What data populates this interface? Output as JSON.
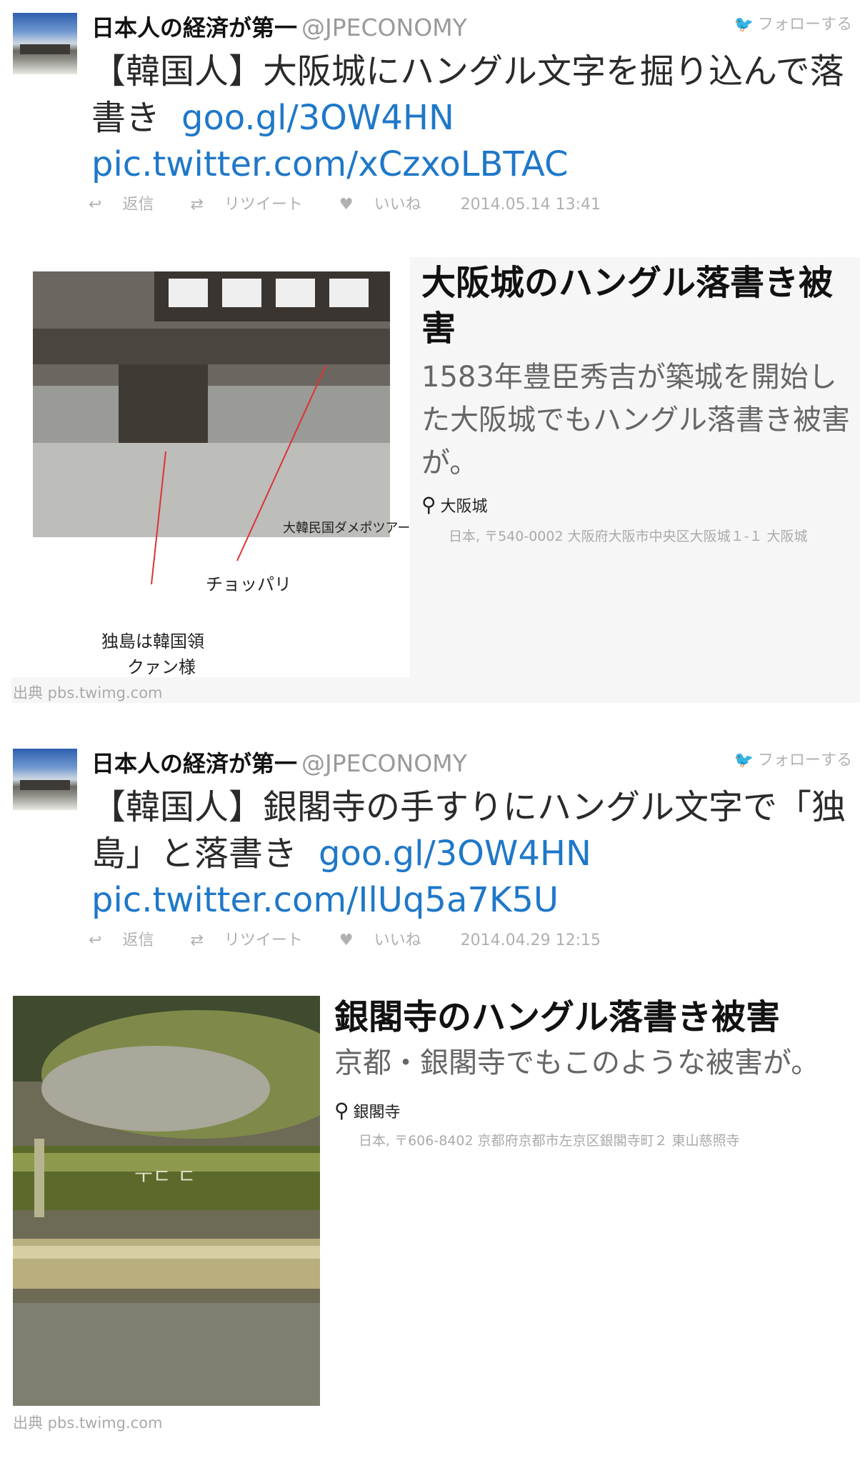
{
  "tweets": [
    {
      "name": "日本人の経済が第一",
      "handle": "@JPECONOMY",
      "follow_label": "フォローする",
      "text": "【韓国人】大阪城にハングル文字を掘り込んで落書き",
      "link": "goo.gl/3OW4HN",
      "pic_link": "pic.twitter.com/xCzxoLBTAC",
      "actions": {
        "reply": "返信",
        "retweet": "リツイート",
        "like": "いいね"
      },
      "date": "2014.05.14 13:41",
      "card": {
        "title": "大阪城のハングル落書き被害",
        "description": "1583年豊臣秀吉が築城を開始した大阪城でもハングル落書き被害が。",
        "place": "大阪城",
        "address": "日本, 〒540-0002 大阪府大阪市中央区大阪城１-１ 大阪城",
        "image_annotations": [
          "チョッパリ",
          "独島は韓国領",
          "クァン様"
        ],
        "image_caption": "大韓民国ダメポツアー",
        "source": "出典 pbs.twimg.com"
      }
    },
    {
      "name": "日本人の経済が第一",
      "handle": "@JPECONOMY",
      "follow_label": "フォローする",
      "text": "【韓国人】銀閣寺の手すりにハングル文字で「独島」と落書き",
      "link": "goo.gl/3OW4HN",
      "pic_link": "pic.twitter.com/IlUq5a7K5U",
      "actions": {
        "reply": "返信",
        "retweet": "リツイート",
        "like": "いいね"
      },
      "date": "2014.04.29 12:15",
      "card": {
        "title": "銀閣寺のハングル落書き被害",
        "description": "京都・銀閣寺でもこのような被害が。",
        "place": "銀閣寺",
        "address": "日本, 〒606-8402 京都府京都市左京区銀閣寺町２ 東山慈照寺",
        "source": "出典 pbs.twimg.com"
      }
    }
  ],
  "icons": {
    "bird": "twitter-bird-icon",
    "reply": "reply-arrow-icon",
    "retweet": "retweet-icon",
    "like": "heart-icon",
    "pin": "map-pin-icon"
  },
  "colors": {
    "link": "#1f78c8",
    "muted": "#b0b0b0",
    "card_bg": "#f6f6f6"
  }
}
